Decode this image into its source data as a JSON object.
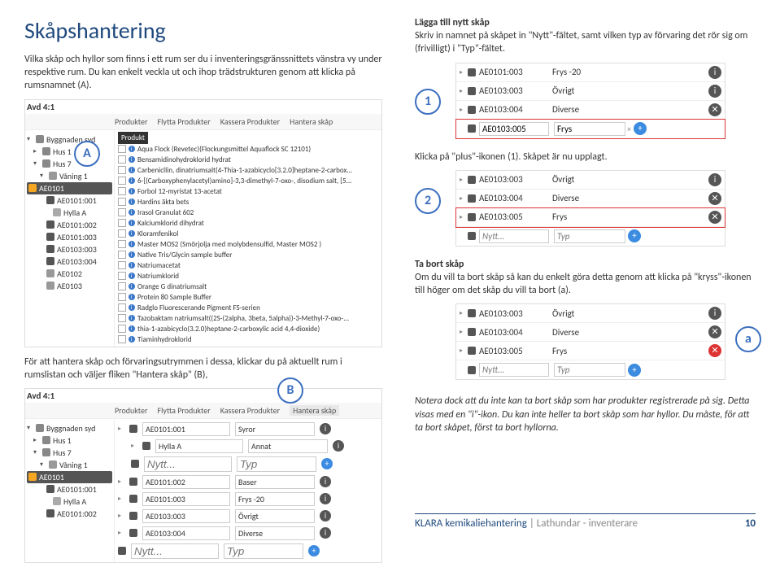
{
  "left": {
    "title": "Skåpshantering",
    "intro": "Vilka skåp och hyllor som finns i ett rum ser du i inventeringsgränssnittets vänstra vy under respektive rum. Du kan enkelt veckla ut och ihop trädstrukturen genom att klicka på rumsnamnet (A).",
    "mid_para": "För att hantera skåp och förvaringsutrymmen i dessa, klickar du på aktuellt rum i rumslistan och väljer fliken \"Hantera skåp\" (B),",
    "avd_label": "Avd 4:1",
    "tabs": {
      "p": "Produkter",
      "f": "Flytta Produkter",
      "k": "Kassera Produkter",
      "h": "Hantera skåp"
    },
    "prod_head": "Produkt",
    "tree": {
      "root": "Byggnaden syd",
      "hus1": "Hus 1",
      "hus7": "Hus 7",
      "vaning": "Våning 1",
      "room": "AE0101",
      "r1": "AE0101:001",
      "hyllaA": "Hylla A",
      "r2": "AE0101:002",
      "r3": "AE0101:003",
      "r4": "AE0103:003",
      "r5": "AE0103:004",
      "cab2": "AE0102",
      "cab3": "AE0103"
    },
    "products": [
      "Aqua Flock (Revetec)(Flockungsmittel Aquaflock SC 12101)",
      "Bensamidinohydroklorid hydrat",
      "Carbenicllin, dinatriumsalt(4-Thia-1-azabicyclo[3.2.0]heptane-2-carbox...",
      "6-[(Carboxyphenylacetyl)amino]-3,3-dimethyl-7-oxo-, disodium salt, [5...",
      "Forbol 12-myristat 13-acetat",
      "Hardins äkta bets",
      "Irasol Granulat 602",
      "Kalciumklorid dihydrat",
      "Kloramfenikol",
      "Master MOS2 (Smörjolja med molybdensulfid, Master MOS2 )",
      "Native Tris/Glycin sample buffer",
      "Natriumacetat",
      "Natriumklorid",
      "Orange G dinatriumsalt",
      "Protein 80 Sample Buffer",
      "Radglo Fluorescerande Pigment FS-serien",
      "Tazobaktam natriumsalt((2S-(2alpha, 3beta, 5alpha))-3-Methyl-7-oxo-...",
      "thia-1-azabicyclo(3.2.0)heptane-2-carboxylic acid 4,4-dioxide)",
      "Tiaminhydroklorid"
    ],
    "hantera": {
      "rows": [
        {
          "name": "AE0101:001",
          "typ": "Syror"
        },
        {
          "name": "Hylla A",
          "typ": "Annat",
          "child": true
        },
        {
          "name": "Nytt...",
          "typ": "Typ",
          "new": true,
          "child": true
        },
        {
          "name": "AE0101:002",
          "typ": "Baser"
        },
        {
          "name": "AE0101:003",
          "typ": "Frys -20"
        },
        {
          "name": "AE0103:003",
          "typ": "Övrigt"
        },
        {
          "name": "AE0103:004",
          "typ": "Diverse"
        },
        {
          "name": "Nytt...",
          "typ": "Typ",
          "new": true
        }
      ],
      "tree": {
        "hyllaA": "Hylla A",
        "r2": "AE0101:002"
      }
    }
  },
  "right": {
    "h_add": "Lägga till nytt skåp",
    "p_add": "Skriv in namnet på skåpet in \"Nytt\"-fältet, samt vilken typ av förvaring det rör sig om (frivilligt) i \"Typ\"-fältet.",
    "p_click": "Klicka på \"plus\"-ikonen (1). Skåpet är nu upplagt.",
    "h_del": "Ta bort skåp",
    "p_del": "Om du vill ta bort skåp så kan du enkelt göra detta genom att klicka på \"kryss\"-ikonen till höger om det skåp du vill ta bort (a).",
    "note": "Notera dock att du inte kan ta bort skåp som har produkter registrerade på sig. Detta visas med en \"i\"-ikon. Du kan inte heller ta bort skåp som har hyllor. Du måste, för att ta bort skåpet, först ta bort hyllorna.",
    "table1": [
      {
        "code": "AE0101:003",
        "typ": "Frys -20",
        "act": "info",
        "drawer": true
      },
      {
        "code": "AE0103:003",
        "typ": "Övrigt",
        "act": "info",
        "drawer": true
      },
      {
        "code": "AE0103:004",
        "typ": "Diverse",
        "act": "del",
        "drawer": true
      }
    ],
    "new_row": {
      "name_val": "AE0103:005",
      "typ_val": "Frys",
      "new_ph": "Nytt...",
      "typ_ph": "Typ"
    },
    "table2": [
      {
        "code": "AE0103:003",
        "typ": "Övrigt",
        "act": "info"
      },
      {
        "code": "AE0103:004",
        "typ": "Diverse",
        "act": "del"
      },
      {
        "code": "AE0103:005",
        "typ": "Frys",
        "act": "del",
        "hl": true
      }
    ],
    "table3": [
      {
        "code": "AE0103:003",
        "typ": "Övrigt",
        "act": "info"
      },
      {
        "code": "AE0103:004",
        "typ": "Diverse",
        "act": "del"
      },
      {
        "code": "AE0103:005",
        "typ": "Frys",
        "act": "del",
        "red": true
      }
    ]
  },
  "callouts": {
    "A": "A",
    "B": "B",
    "one": "1",
    "two": "2",
    "a": "a"
  },
  "footer": {
    "title": "KLARA kemikaliehantering",
    "sub": "Lathundar - inventerare",
    "page": "10"
  }
}
